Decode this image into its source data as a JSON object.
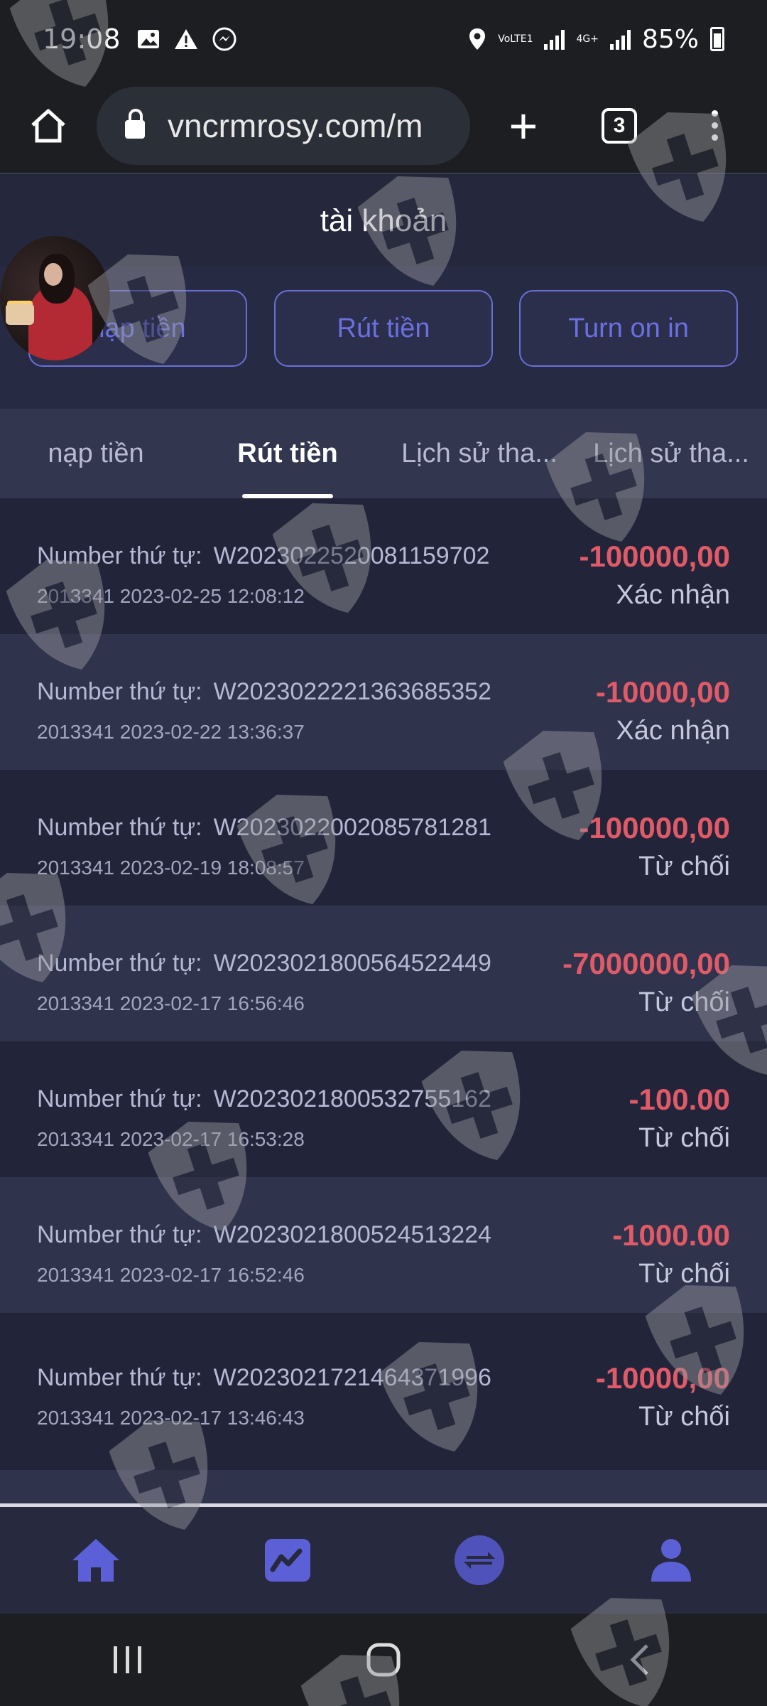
{
  "status_bar": {
    "time": "19:08",
    "net1": "VoLTE1",
    "net2": "4G+",
    "battery": "85%"
  },
  "browser": {
    "url": "vncrmrosy.com/m",
    "tab_count": "3"
  },
  "page": {
    "title": "tài khoản",
    "actions": [
      "nạp tiền",
      "Rút tiền",
      "Turn on in"
    ],
    "tabs": [
      "nạp tiền",
      "Rút tiền",
      "Lịch sử tha...",
      "Lịch sử tha..."
    ],
    "active_tab": 1
  },
  "transactions": [
    {
      "label": "Number thứ tự:",
      "id": "W2023022520081159702",
      "user": "2013341",
      "datetime": "2023-02-25 12:08:12",
      "amount": "-100000,00",
      "status": "Xác nhận"
    },
    {
      "label": "Number thứ tự:",
      "id": "W2023022221363685352",
      "user": "2013341",
      "datetime": "2023-02-22 13:36:37",
      "amount": "-10000,00",
      "status": "Xác nhận"
    },
    {
      "label": "Number thứ tự:",
      "id": "W2023022002085781281",
      "user": "2013341",
      "datetime": "2023-02-19 18:08:57",
      "amount": "-100000,00",
      "status": "Từ chối"
    },
    {
      "label": "Number thứ tự:",
      "id": "W2023021800564522449",
      "user": "2013341",
      "datetime": "2023-02-17 16:56:46",
      "amount": "-7000000,00",
      "status": "Từ chối"
    },
    {
      "label": "Number thứ tự:",
      "id": "W2023021800532755162",
      "user": "2013341",
      "datetime": "2023-02-17 16:53:28",
      "amount": "-100.00",
      "status": "Từ chối"
    },
    {
      "label": "Number thứ tự:",
      "id": "W2023021800524513224",
      "user": "2013341",
      "datetime": "2023-02-17 16:52:46",
      "amount": "-1000.00",
      "status": "Từ chối"
    },
    {
      "label": "Number thứ tự:",
      "id": "W2023021721464371996",
      "user": "2013341",
      "datetime": "2023-02-17 13:46:43",
      "amount": "-10000,00",
      "status": "Từ chối"
    }
  ],
  "colors": {
    "accent": "#5c60d6",
    "negative_amount": "#e15a67",
    "background": "#22253a"
  },
  "bottom_nav": [
    "home-icon",
    "chart-icon",
    "exchange-icon",
    "user-icon"
  ],
  "watermark_icon": "shield-cross-icon"
}
